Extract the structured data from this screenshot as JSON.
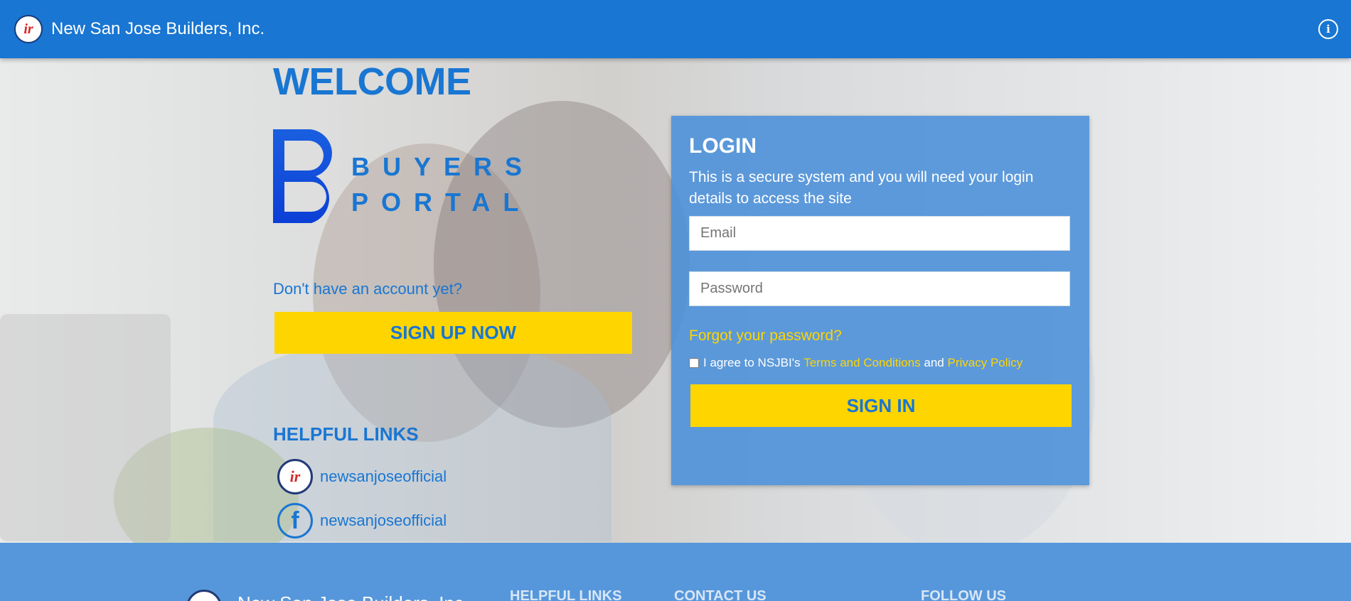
{
  "header": {
    "company_name": "New San Jose Builders, Inc.",
    "logo_text": "ir",
    "info_icon": "info-icon",
    "info_glyph": "i",
    "background_color": "#1976d2"
  },
  "welcome": {
    "title": "WELCOME"
  },
  "brand_logo": {
    "line1": "BUYERS",
    "line2": "PORTAL"
  },
  "signup": {
    "prompt": "Don't have an account yet?",
    "button_label": "SIGN UP NOW"
  },
  "helpful_links": {
    "title": "HELPFUL LINKS",
    "items": [
      {
        "icon": "nsjbi-logo-icon",
        "glyph": "ir",
        "label": "newsanjoseofficial"
      },
      {
        "icon": "facebook-icon",
        "glyph": "f",
        "label": "newsanjoseofficial"
      }
    ]
  },
  "login": {
    "title": "LOGIN",
    "description": "This is a secure system and you will need your login details to access the site",
    "email_placeholder": "Email",
    "password_placeholder": "Password",
    "forgot_label": "Forgot your password?",
    "agree_prefix": "I agree to NSJBI's",
    "terms_label": "Terms and Conditions",
    "and_label": "and",
    "privacy_label": "Privacy Policy",
    "agree_checked": false,
    "signin_label": "SIGN IN"
  },
  "footer": {
    "company_name": "New San Jose Builders, Inc.",
    "columns": [
      "HELPFUL LINKS",
      "CONTACT US",
      "FOLLOW US"
    ]
  },
  "colors": {
    "primary": "#1976d2",
    "accent_yellow": "#ffd500",
    "card_blue": "#4a90d9"
  }
}
